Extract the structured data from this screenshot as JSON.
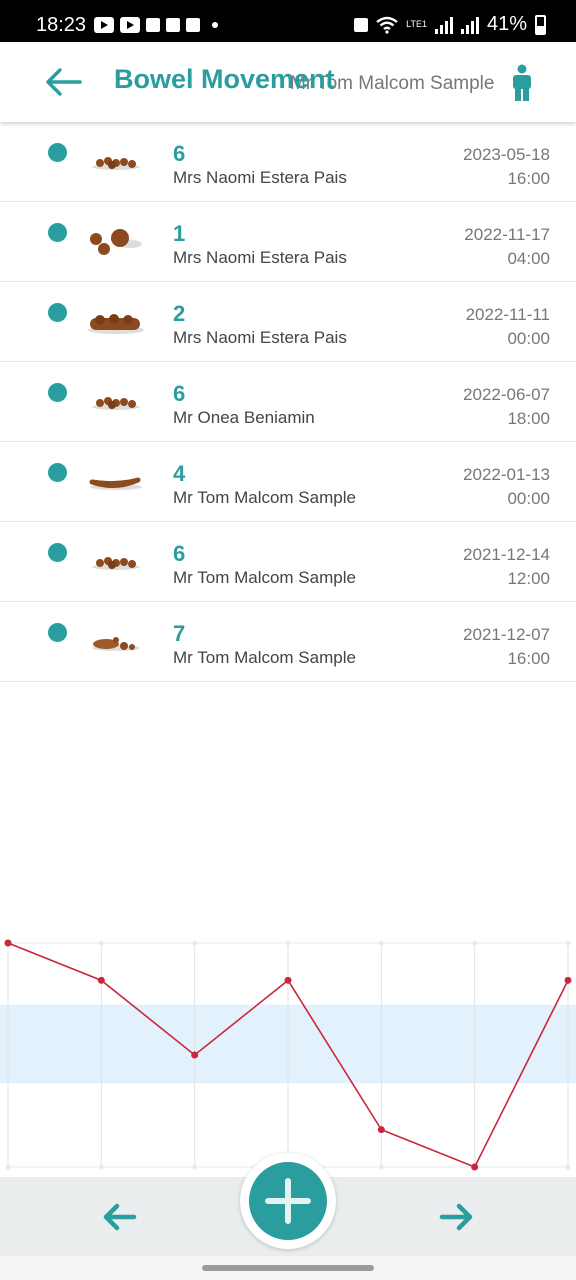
{
  "status_bar": {
    "time": "18:23",
    "battery": "41%",
    "network": "LTE1",
    "icons": [
      "youtube-icon",
      "youtube-icon",
      "home-icon",
      "camera-icon",
      "image-icon",
      "dot-icon",
      "cast-icon",
      "wifi-icon",
      "signal-icon",
      "battery-icon"
    ]
  },
  "header": {
    "title": "Bowel Movement",
    "patient": "Mr Tom Malcom Sample",
    "back_icon": "arrow-left-icon",
    "person_icon": "person-icon"
  },
  "entries": [
    {
      "type": "6",
      "person": "Mrs Naomi Estera Pais",
      "date": "2023-05-18",
      "time": "16:00"
    },
    {
      "type": "1",
      "person": "Mrs Naomi Estera Pais",
      "date": "2022-11-17",
      "time": "04:00"
    },
    {
      "type": "2",
      "person": "Mrs Naomi Estera Pais",
      "date": "2022-11-11",
      "time": "00:00"
    },
    {
      "type": "6",
      "person": "Mr Onea  Beniamin",
      "date": "2022-06-07",
      "time": "18:00"
    },
    {
      "type": "4",
      "person": "Mr Tom Malcom Sample",
      "date": "2022-01-13",
      "time": "00:00"
    },
    {
      "type": "6",
      "person": "Mr Tom Malcom Sample",
      "date": "2021-12-14",
      "time": "12:00"
    },
    {
      "type": "7",
      "person": "Mr Tom Malcom Sample",
      "date": "2021-12-07",
      "time": "16:00"
    }
  ],
  "chart_data": {
    "type": "line",
    "x": [
      1,
      2,
      3,
      4,
      5,
      6,
      7
    ],
    "series": [
      {
        "values": [
          7,
          6,
          4,
          6,
          2,
          1,
          6
        ],
        "color": "#c8283c"
      }
    ],
    "ylim": [
      1,
      7
    ],
    "normal_band": [
      3,
      5
    ],
    "band_color": "#e3f1fc",
    "grid": true
  },
  "bottom_bar": {
    "prev_icon": "arrow-left-icon",
    "add_icon": "plus-icon",
    "next_icon": "arrow-right-icon"
  },
  "colors": {
    "accent": "#2a9d9f",
    "line": "#c8283c"
  }
}
